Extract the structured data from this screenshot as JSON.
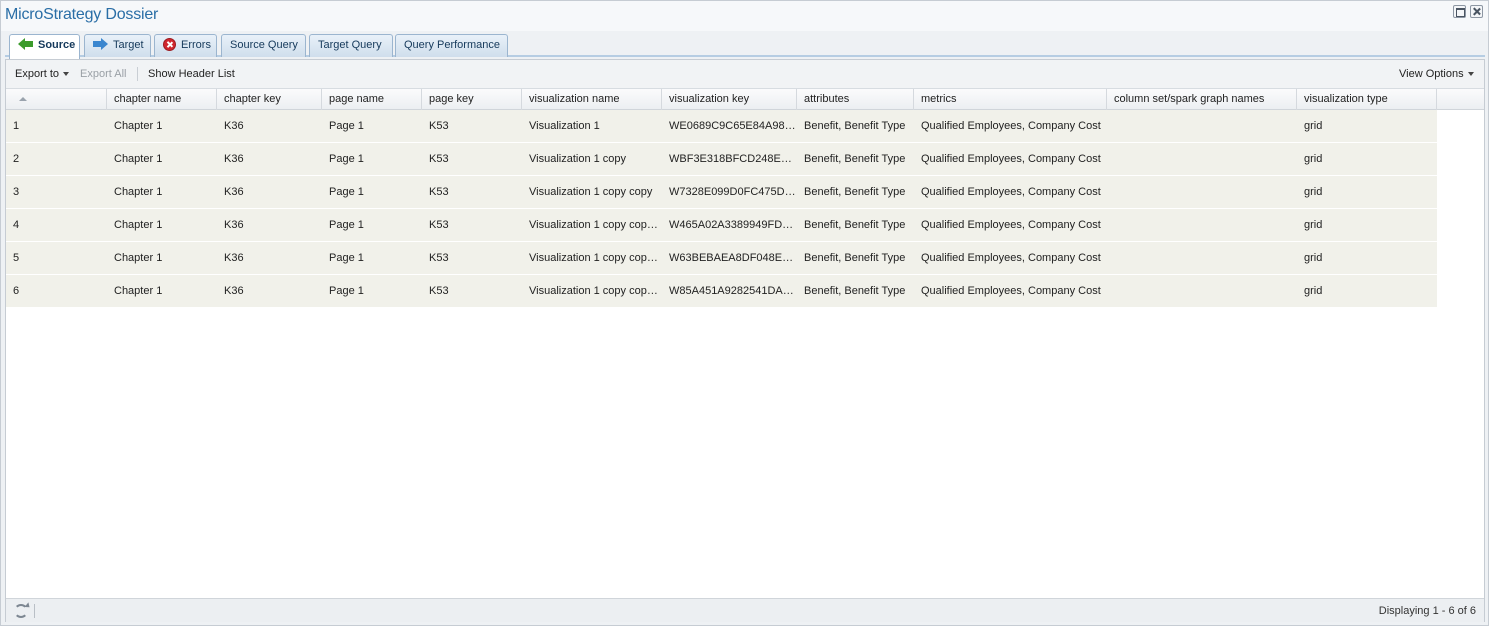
{
  "window": {
    "title": "MicroStrategy Dossier"
  },
  "tabs": [
    {
      "label": "Source",
      "icon": "arrow-left-icon",
      "active": true
    },
    {
      "label": "Target",
      "icon": "arrow-right-icon",
      "active": false
    },
    {
      "label": "Errors",
      "icon": "error-icon",
      "active": false
    },
    {
      "label": "Source Query",
      "icon": "",
      "active": false
    },
    {
      "label": "Target Query",
      "icon": "",
      "active": false
    },
    {
      "label": "Query Performance",
      "icon": "",
      "active": false
    }
  ],
  "toolbar": {
    "export_to": "Export to",
    "export_all": "Export All",
    "show_header_list": "Show Header List",
    "view_options": "View Options"
  },
  "grid": {
    "columns": [
      "",
      "chapter name",
      "chapter key",
      "page name",
      "page key",
      "visualization name",
      "visualization key",
      "attributes",
      "metrics",
      "column set/spark graph names",
      "visualization type"
    ],
    "rows": [
      [
        "1",
        "Chapter 1",
        "K36",
        "Page 1",
        "K53",
        "Visualization 1",
        "WE0689C9C65E84A98…",
        "Benefit, Benefit Type",
        "Qualified Employees, Company Cost",
        "",
        "grid"
      ],
      [
        "2",
        "Chapter 1",
        "K36",
        "Page 1",
        "K53",
        "Visualization 1 copy",
        "WBF3E318BFCD248E8…",
        "Benefit, Benefit Type",
        "Qualified Employees, Company Cost",
        "",
        "grid"
      ],
      [
        "3",
        "Chapter 1",
        "K36",
        "Page 1",
        "K53",
        "Visualization 1 copy copy",
        "W7328E099D0FC475D…",
        "Benefit, Benefit Type",
        "Qualified Employees, Company Cost",
        "",
        "grid"
      ],
      [
        "4",
        "Chapter 1",
        "K36",
        "Page 1",
        "K53",
        "Visualization 1 copy cop…",
        "W465A02A3389949FD…",
        "Benefit, Benefit Type",
        "Qualified Employees, Company Cost",
        "",
        "grid"
      ],
      [
        "5",
        "Chapter 1",
        "K36",
        "Page 1",
        "K53",
        "Visualization 1 copy cop…",
        "W63BEBAEA8DF048E7…",
        "Benefit, Benefit Type",
        "Qualified Employees, Company Cost",
        "",
        "grid"
      ],
      [
        "6",
        "Chapter 1",
        "K36",
        "Page 1",
        "K53",
        "Visualization 1 copy cop…",
        "W85A451A9282541DA…",
        "Benefit, Benefit Type",
        "Qualified Employees, Company Cost",
        "",
        "grid"
      ]
    ]
  },
  "status": {
    "display_text": "Displaying 1 - 6 of 6"
  }
}
